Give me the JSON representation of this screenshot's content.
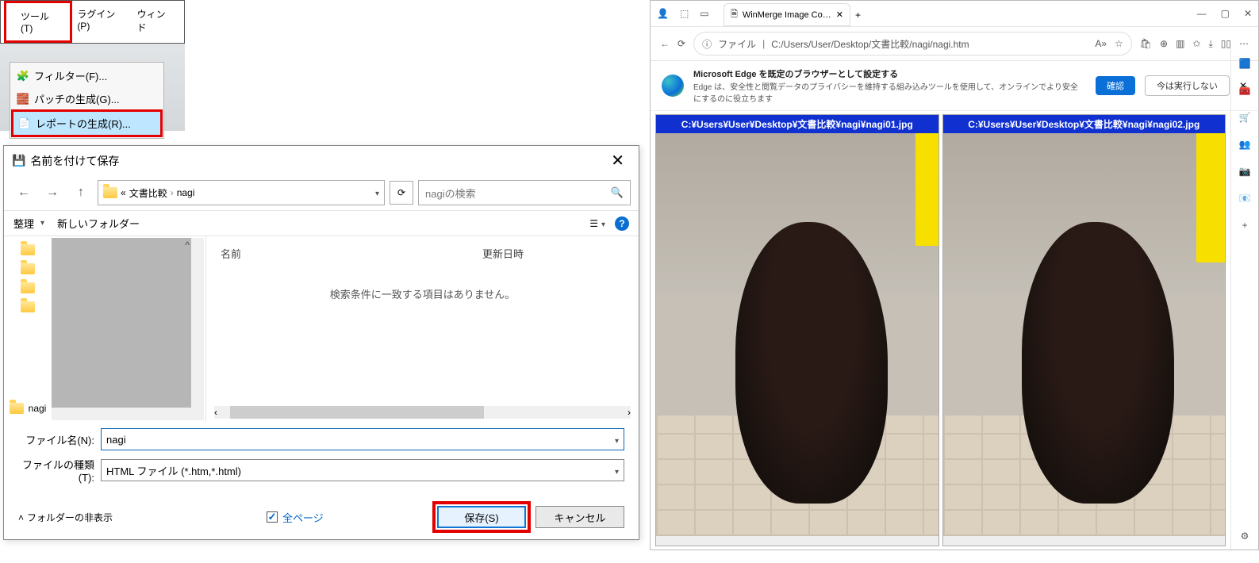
{
  "menubar": {
    "tools": "ツール(T)",
    "plugin": "ラグイン(P)",
    "window": "ウィンド",
    "submenu": {
      "filter": "フィルター(F)...",
      "patch": "パッチの生成(G)...",
      "report": "レポートの生成(R)..."
    }
  },
  "dialog": {
    "title": "名前を付けて保存",
    "breadcrumb": {
      "root": "«",
      "p1": "文書比較",
      "p2": "nagi"
    },
    "search_placeholder": "nagiの検索",
    "toolbar": {
      "organize": "整理",
      "newfolder": "新しいフォルダー"
    },
    "headers": {
      "name": "名前",
      "date": "更新日時"
    },
    "empty": "検索条件に一致する項目はありません。",
    "tree_folder": "nagi",
    "filename_lbl": "ファイル名(N):",
    "filetype_lbl": "ファイルの種類(T):",
    "filename_val": "nagi",
    "filetype_val": "HTML ファイル (*.htm,*.html)",
    "hide_folders": "フォルダーの非表示",
    "all_pages": "全ページ",
    "save": "保存(S)",
    "cancel": "キャンセル"
  },
  "browser": {
    "tab_title": "WinMerge Image Compare Rep",
    "addr_prefix": "ファイル",
    "addr": "C:/Users/User/Desktop/文書比較/nagi/nagi.htm",
    "banner_title": "Microsoft Edge を既定のブラウザーとして設定する",
    "banner_sub": "Edge は、安全性と閲覧データのプライバシーを維持する組み込みツールを使用して、オンラインでより安全にするのに役立ちます",
    "banner_confirm": "確認",
    "banner_later": "今は実行しない",
    "pane1": "C:¥Users¥User¥Desktop¥文書比較¥nagi¥nagi01.jpg",
    "pane2": "C:¥Users¥User¥Desktop¥文書比較¥nagi¥nagi02.jpg"
  }
}
